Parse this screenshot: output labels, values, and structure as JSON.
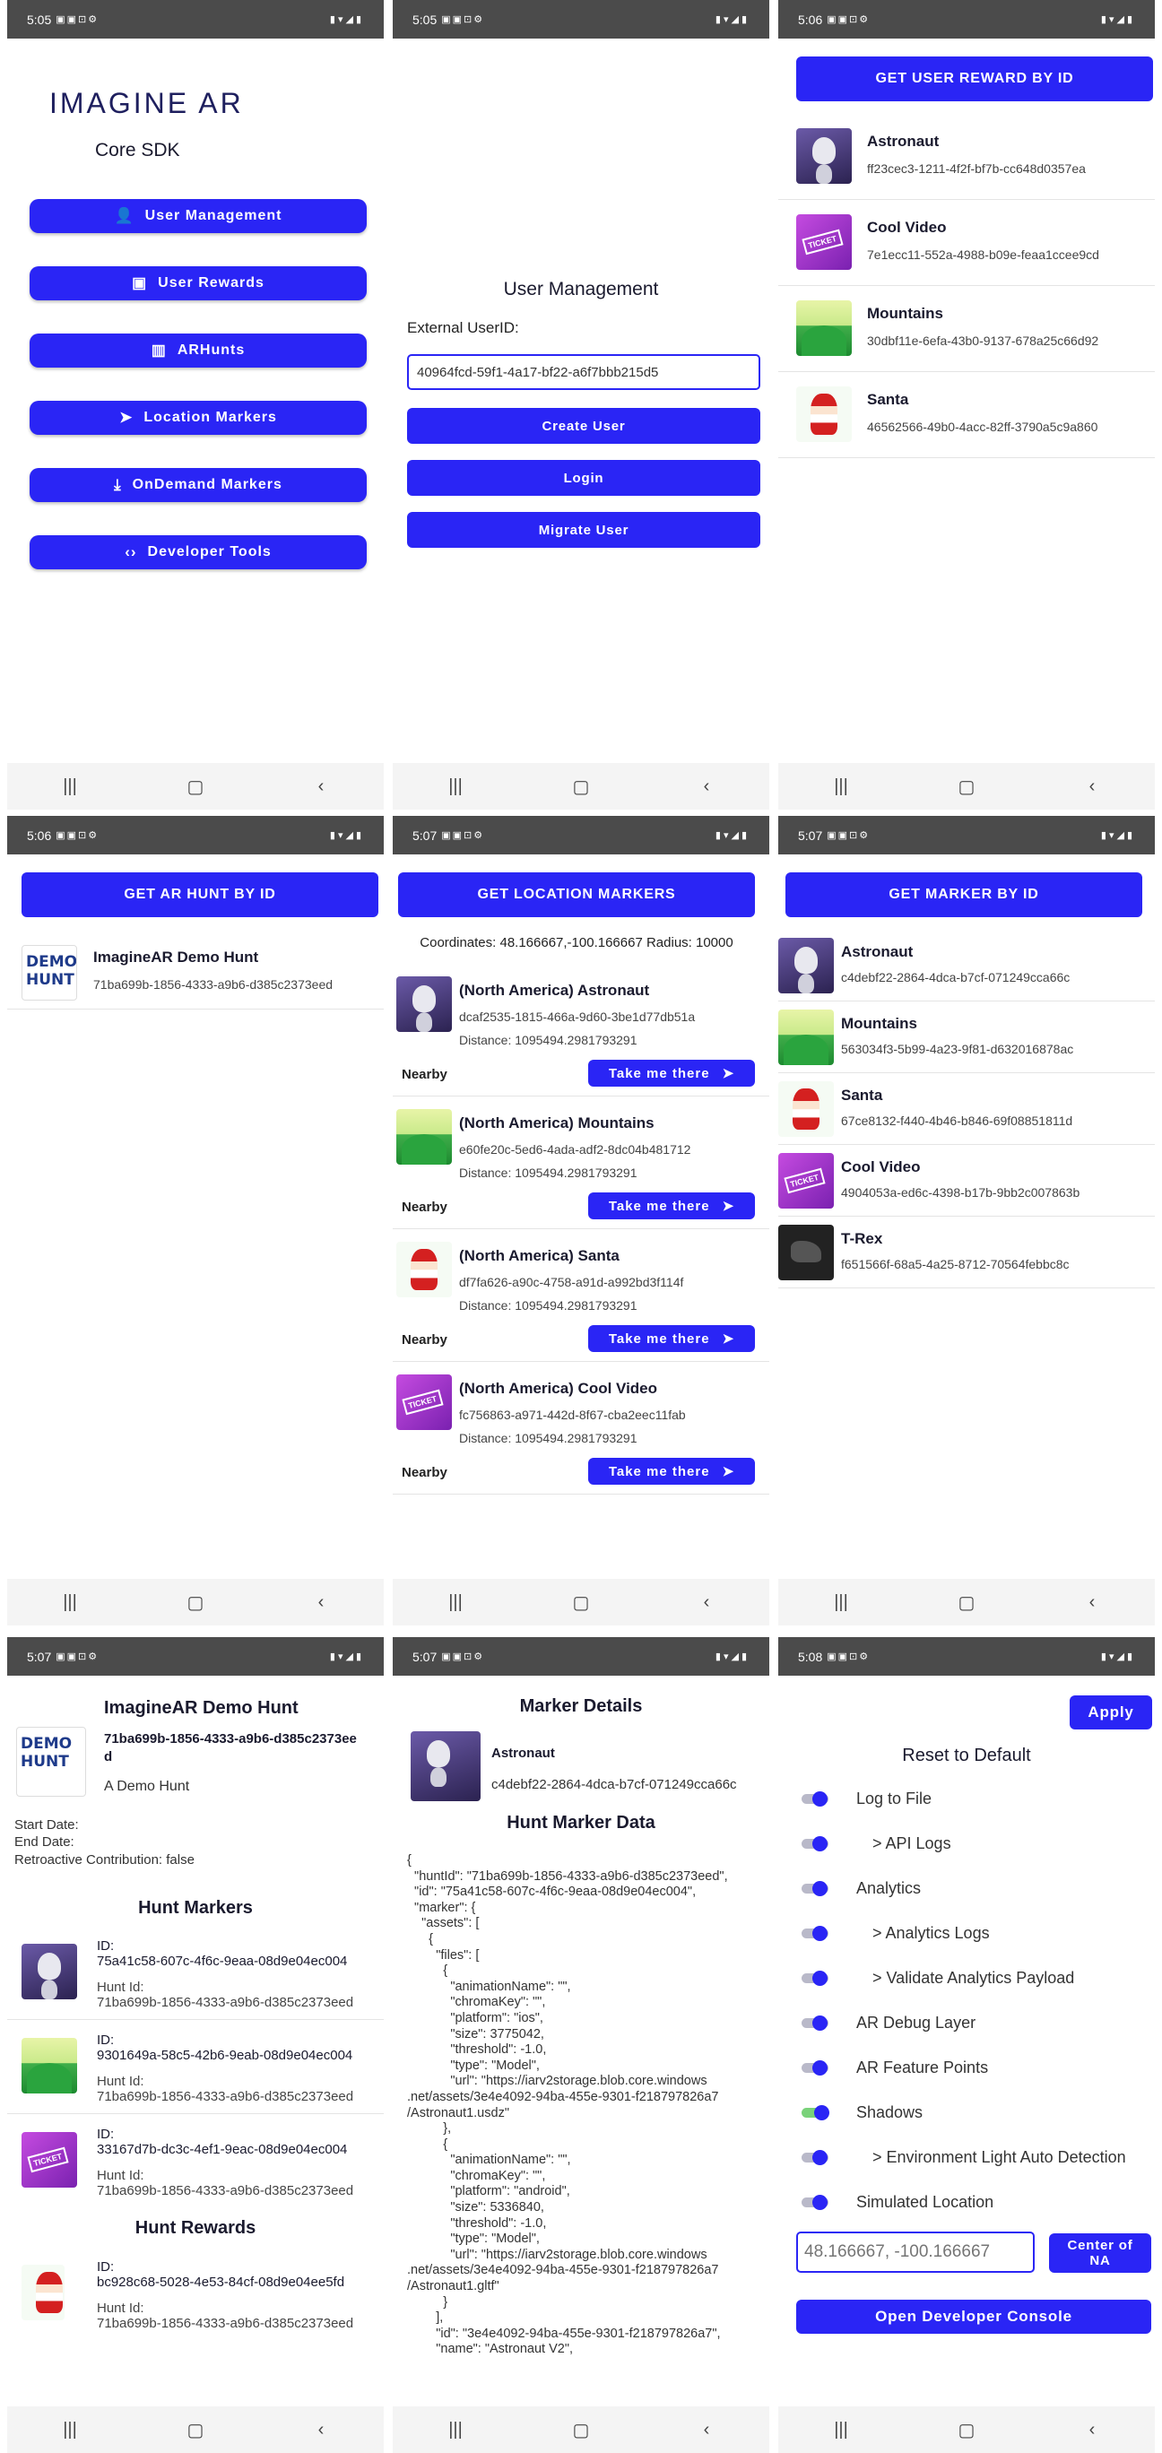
{
  "status_times": [
    "5:05",
    "5:05",
    "5:06",
    "5:06",
    "5:07",
    "5:07",
    "5:07",
    "5:07",
    "5:08"
  ],
  "home": {
    "logo": "IMAGINE AR",
    "subtitle": "Core SDK",
    "buttons": [
      "User Management",
      "User Rewards",
      "ARHunts",
      "Location Markers",
      "OnDemand Markers",
      "Developer Tools"
    ]
  },
  "user_mgmt": {
    "title": "User Management",
    "label": "External UserID:",
    "input_value": "40964fcd-59f1-4a17-bf22-a6f7bbb215d5",
    "buttons": [
      "Create User",
      "Login",
      "Migrate User"
    ]
  },
  "rewards": {
    "button": "GET USER REWARD BY ID",
    "items": [
      {
        "title": "Astronaut",
        "id": "ff23cec3-1211-4f2f-bf7b-cc648d0357ea"
      },
      {
        "title": "Cool Video",
        "id": "7e1ecc11-552a-4988-b09e-feaa1ccee9cd"
      },
      {
        "title": "Mountains",
        "id": "30dbf11e-6efa-43b0-9137-678a25c66d92"
      },
      {
        "title": "Santa",
        "id": "46562566-49b0-4acc-82ff-3790a5c9a860"
      }
    ]
  },
  "hunt_list": {
    "button": "GET AR HUNT BY ID",
    "items": [
      {
        "title": "ImagineAR Demo Hunt",
        "id": "71ba699b-1856-4333-a9b6-d385c2373eed"
      }
    ]
  },
  "location": {
    "button": "GET LOCATION MARKERS",
    "coords": "Coordinates: 48.166667,-100.166667 Radius: 10000",
    "nearby": "Nearby",
    "take": "Take me there",
    "items": [
      {
        "title": "(North America) Astronaut",
        "id": "dcaf2535-1815-466a-9d60-3be1d77db51a",
        "dist": "Distance: 1095494.2981793291"
      },
      {
        "title": "(North America) Mountains",
        "id": "e60fe20c-5ed6-4ada-adf2-8dc04b481712",
        "dist": "Distance: 1095494.2981793291"
      },
      {
        "title": "(North America) Santa",
        "id": "df7fa626-a90c-4758-a91d-a992bd3f114f",
        "dist": "Distance: 1095494.2981793291"
      },
      {
        "title": "(North America) Cool Video",
        "id": "fc756863-a971-442d-8f67-cba2eec11fab",
        "dist": "Distance: 1095494.2981793291"
      }
    ]
  },
  "markers": {
    "button": "GET MARKER BY ID",
    "items": [
      {
        "title": "Astronaut",
        "id": "c4debf22-2864-4dca-b7cf-071249cca66c"
      },
      {
        "title": "Mountains",
        "id": "563034f3-5b99-4a23-9f81-d632016878ac"
      },
      {
        "title": "Santa",
        "id": "67ce8132-f440-4b46-b846-69f08851811d"
      },
      {
        "title": "Cool Video",
        "id": "4904053a-ed6c-4398-b17b-9bb2c007863b"
      },
      {
        "title": "T-Rex",
        "id": "f651566f-68a5-4a25-8712-70564febbc8c"
      }
    ]
  },
  "hunt_detail": {
    "title": "ImagineAR Demo Hunt",
    "id_line1": "71ba699b-1856-4333-a9b6-d385c2373ee",
    "id_line2": "d",
    "desc": "A Demo Hunt",
    "start": "Start Date:",
    "end": "End Date:",
    "retro": "Retroactive Contribution: false",
    "markers_head": "Hunt Markers",
    "rewards_head": "Hunt Rewards",
    "id_label": "ID:",
    "hunt_label": "Hunt Id:",
    "hunt_id": "71ba699b-1856-4333-a9b6-d385c2373eed",
    "markers": [
      "75a41c58-607c-4f6c-9eaa-08d9e04ec004",
      "9301649a-58c5-42b6-9eab-08d9e04ec004",
      "33167d7b-dc3c-4ef1-9eac-08d9e04ec004"
    ],
    "reward_id": "bc928c68-5028-4e53-84cf-08d9e04ee5fd"
  },
  "marker_detail": {
    "title": "Marker Details",
    "name": "Astronaut",
    "id": "c4debf22-2864-4dca-b7cf-071249cca66c",
    "data_head": "Hunt Marker Data",
    "json": "{\n  \"huntId\": \"71ba699b-1856-4333-a9b6-d385c2373eed\",\n  \"id\": \"75a41c58-607c-4f6c-9eaa-08d9e04ec004\",\n  \"marker\": {\n    \"assets\": [\n      {\n        \"files\": [\n          {\n            \"animationName\": \"\",\n            \"chromaKey\": \"\",\n            \"platform\": \"ios\",\n            \"size\": 3775042,\n            \"threshold\": -1.0,\n            \"type\": \"Model\",\n            \"url\": \"https://iarv2storage.blob.core.windows\n.net/assets/3e4e4092-94ba-455e-9301-f218797826a7\n/Astronaut1.usdz\"\n          },\n          {\n            \"animationName\": \"\",\n            \"chromaKey\": \"\",\n            \"platform\": \"android\",\n            \"size\": 5336840,\n            \"threshold\": -1.0,\n            \"type\": \"Model\",\n            \"url\": \"https://iarv2storage.blob.core.windows\n.net/assets/3e4e4092-94ba-455e-9301-f218797826a7\n/Astronaut1.gltf\"\n          }\n        ],\n        \"id\": \"3e4e4092-94ba-455e-9301-f218797826a7\",\n        \"name\": \"Astronaut V2\","
  },
  "dev": {
    "apply": "Apply",
    "reset": "Reset to Default",
    "settings": [
      {
        "label": "Log to File",
        "on": false
      },
      {
        "label": "> API Logs",
        "on": false
      },
      {
        "label": "Analytics",
        "on": false
      },
      {
        "label": "> Analytics Logs",
        "on": false
      },
      {
        "label": "> Validate Analytics Payload",
        "on": false
      },
      {
        "label": "AR Debug Layer",
        "on": false
      },
      {
        "label": "AR Feature Points",
        "on": false
      },
      {
        "label": "Shadows",
        "on": true
      },
      {
        "label": "> Environment Light Auto Detection",
        "on": false
      },
      {
        "label": "Simulated Location",
        "on": false
      }
    ],
    "location_placeholder": "48.166667, -100.166667",
    "center_btn": "Center of NA",
    "console_btn": "Open Developer Console"
  }
}
